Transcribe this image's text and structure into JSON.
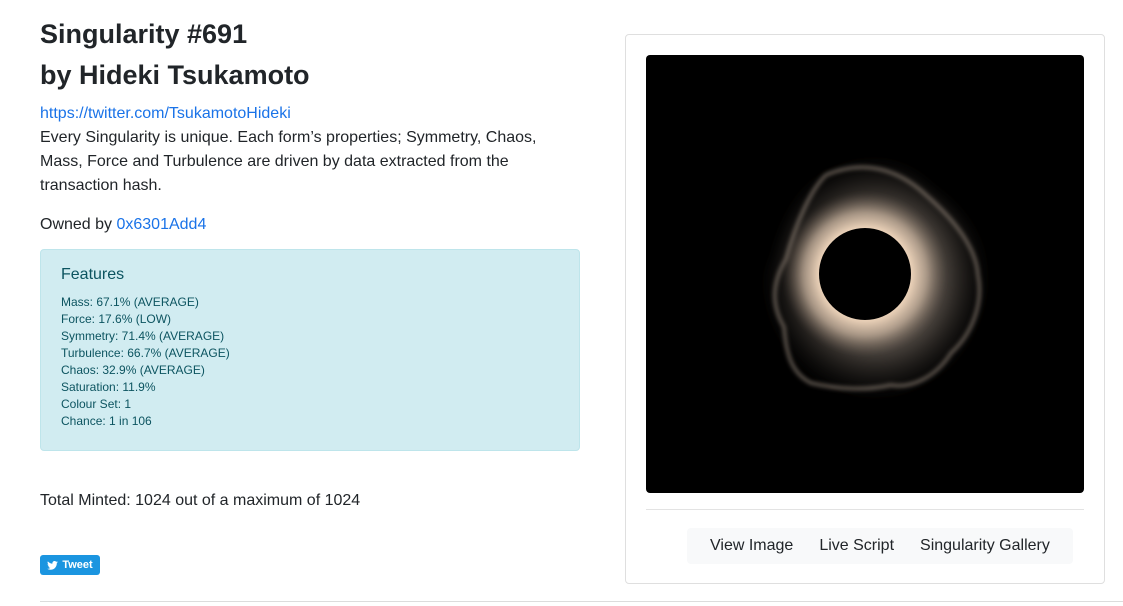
{
  "header": {
    "title": "Singularity #691",
    "byline": "by Hideki Tsukamoto",
    "twitter_link": "https://twitter.com/TsukamotoHideki",
    "description": "Every Singularity is unique. Each form’s properties; Symmetry, Chaos, Mass, Force and Turbulence are driven by data extracted from the transaction hash."
  },
  "owner": {
    "label": "Owned by ",
    "address": "0x6301Add4"
  },
  "features": {
    "heading": "Features",
    "items": [
      "Mass: 67.1% (AVERAGE)",
      "Force: 17.6% (LOW)",
      "Symmetry: 71.4% (AVERAGE)",
      "Turbulence: 66.7% (AVERAGE)",
      "Chaos: 32.9% (AVERAGE)",
      "Saturation: 11.9%",
      "Colour Set: 1",
      "Chance: 1 in 106"
    ]
  },
  "minted": "Total Minted: 1024 out of a maximum of 1024",
  "tweet_button": "Tweet",
  "artwork_buttons": {
    "view_image": "View Image",
    "live_script": "Live Script",
    "gallery": "Singularity Gallery"
  },
  "colors": {
    "link": "#1a73e8",
    "features_bg": "#d1ecf1",
    "features_text": "#0c5460",
    "tweet_bg": "#1b95e0",
    "art_bg": "#000000",
    "glow": "#f3dcc4"
  },
  "icons": {
    "tweet": "twitter-bird-icon"
  }
}
